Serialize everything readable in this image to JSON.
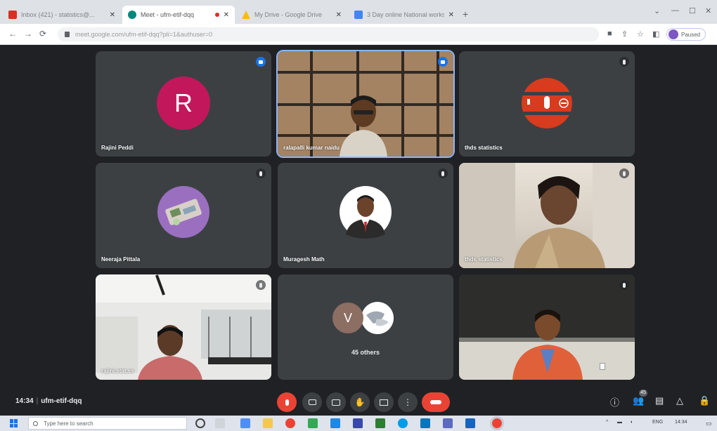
{
  "browser": {
    "tabs": [
      {
        "label": "Inbox (421) - statistics@...",
        "favicon_color": "#d93025",
        "active": false
      },
      {
        "label": "Meet - ufm-etif-dqq",
        "favicon_color": "#00897b",
        "active": true,
        "recording": true
      },
      {
        "label": "My Drive - Google Drive",
        "favicon_color": "#fbbc04",
        "active": false
      },
      {
        "label": "3 Day online National worksho...",
        "favicon_color": "#4285f4",
        "active": false
      }
    ],
    "url": "meet.google.com/ufm-etif-dqq?pli=1&authuser=0",
    "profile_label": "Paused"
  },
  "tiles": [
    {
      "name": "Rajini Peddi",
      "kind": "avatar",
      "letter": "R",
      "avatar_color": "#c2185b",
      "mic": "active"
    },
    {
      "name": "ralapalli kumar naidu",
      "kind": "video-grid",
      "mic": "active",
      "speaking": true
    },
    {
      "name": "thds statistics",
      "kind": "presenting",
      "mic": "muted"
    },
    {
      "name": "Neeraja Pittala",
      "kind": "photo-avatar",
      "mic": "muted"
    },
    {
      "name": "Muragesh Math",
      "kind": "photo-portrait",
      "mic": "muted"
    },
    {
      "name": "thds statistics",
      "kind": "video-room",
      "mic": "muted"
    },
    {
      "name": "rajini.stat.ss",
      "kind": "video-classroom",
      "mic": "muted"
    },
    {
      "name": "45 others",
      "kind": "others",
      "letter": "V",
      "avatar_color": "#8d6e63",
      "mic": "none"
    },
    {
      "name": "",
      "kind": "video-blackboard",
      "mic": "muted"
    }
  ],
  "meeting": {
    "time": "14:34",
    "code": "ufm-etif-dqq"
  },
  "participants_badge": "45",
  "taskbar": {
    "search_placeholder": "Type here to search",
    "tray_lang": "ENG",
    "tray_time": "14:34"
  },
  "colors": {
    "accent": "#8ab4f8",
    "danger": "#ea4335",
    "tile_bg": "#3c4043",
    "stage_bg": "#202124"
  }
}
